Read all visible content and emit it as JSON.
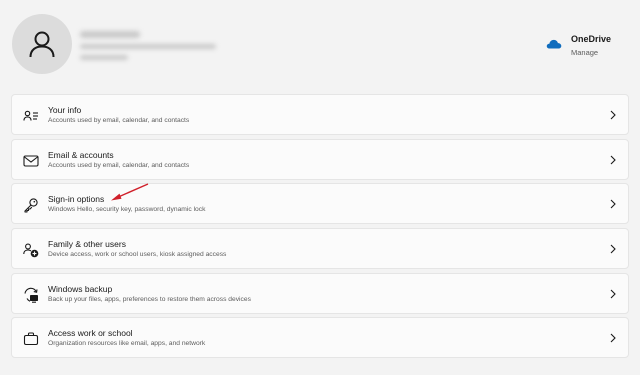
{
  "onedrive": {
    "title": "OneDrive",
    "subtitle": "Manage",
    "icon": "cloud-icon",
    "color": "#0f6cbd"
  },
  "items": [
    {
      "title": "Your info",
      "description": "Accounts used by email, calendar, and contacts",
      "icon": "person-card-icon"
    },
    {
      "title": "Email & accounts",
      "description": "Accounts used by email, calendar, and contacts",
      "icon": "mail-icon"
    },
    {
      "title": "Sign-in options",
      "description": "Windows Hello, security key, password, dynamic lock",
      "icon": "key-icon"
    },
    {
      "title": "Family & other users",
      "description": "Device access, work or school users, kiosk assigned access",
      "icon": "people-add-icon"
    },
    {
      "title": "Windows backup",
      "description": "Back up your files, apps, preferences to restore them across devices",
      "icon": "backup-icon"
    },
    {
      "title": "Access work or school",
      "description": "Organization resources like email, apps, and network",
      "icon": "briefcase-icon"
    }
  ],
  "annotation_color": "#d0202a"
}
